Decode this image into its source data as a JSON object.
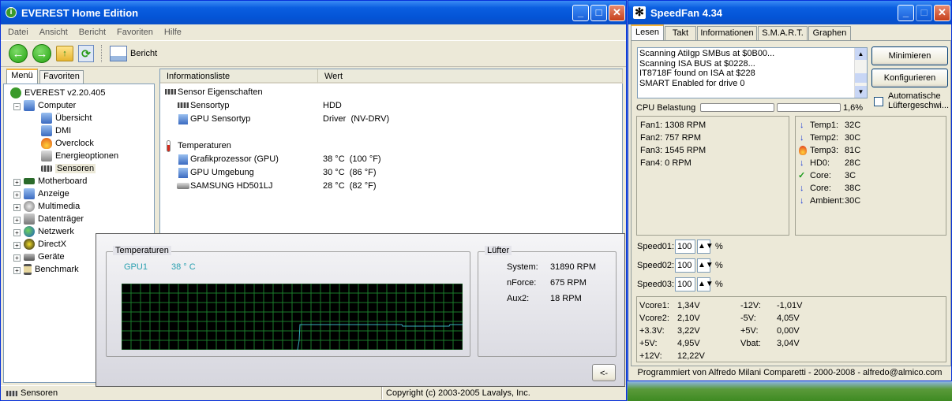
{
  "everest": {
    "title": "EVEREST Home Edition",
    "menu": [
      "Datei",
      "Ansicht",
      "Bericht",
      "Favoriten",
      "Hilfe"
    ],
    "toolbar": {
      "report_label": "Bericht"
    },
    "tabs": [
      "Menü",
      "Favoriten"
    ],
    "tree": {
      "root": "EVEREST v2.20.405",
      "computer": "Computer",
      "computer_children": [
        "Übersicht",
        "DMI",
        "Overclock",
        "Energieoptionen",
        "Sensoren"
      ],
      "others": [
        "Motherboard",
        "Anzeige",
        "Multimedia",
        "Datenträger",
        "Netzwerk",
        "DirectX",
        "Geräte",
        "Benchmark"
      ]
    },
    "columns": [
      "Informationsliste",
      "Wert"
    ],
    "section1": "Sensor Eigenschaften",
    "rows1": [
      {
        "name": "Sensortyp",
        "value": "HDD"
      },
      {
        "name": "GPU Sensortyp",
        "value": "Driver  (NV-DRV)"
      }
    ],
    "section2": "Temperaturen",
    "rows2": [
      {
        "name": "Grafikprozessor (GPU)",
        "value": "38 °C  (100 °F)"
      },
      {
        "name": "GPU Umgebung",
        "value": "30 °C  (86 °F)"
      },
      {
        "name": "SAMSUNG HD501LJ",
        "value": "28 °C  (82 °F)"
      }
    ],
    "status_left": "Sensoren",
    "status_right": "Copyright (c) 2003-2005 Lavalys, Inc."
  },
  "monitor": {
    "temp_legend": "Temperaturen",
    "gpu_label": "GPU1",
    "gpu_value": "38 ° C",
    "fan_legend": "Lüfter",
    "fans": [
      {
        "name": "System:",
        "value": "31890 RPM"
      },
      {
        "name": "nForce:",
        "value": "675 RPM"
      },
      {
        "name": "Aux2:",
        "value": "18 RPM"
      }
    ],
    "back_button": "<-"
  },
  "speedfan": {
    "title": "SpeedFan 4.34",
    "tabs": [
      "Lesen",
      "Takt",
      "Informationen",
      "S.M.A.R.T.",
      "Graphen"
    ],
    "log": [
      "Scanning AtiIgp SMBus at $0B00...",
      "Scanning ISA BUS at $0228...",
      "IT8718F found on ISA at $228",
      "SMART Enabled for drive 0"
    ],
    "minimize_button": "Minimieren",
    "configure_button": "Konfigurieren",
    "auto_fan_label": "Automatische Lüftergeschwi...",
    "cpu_label": "CPU Belastung",
    "cpu_percent": "1,6%",
    "fans": [
      "Fan1: 1308 RPM",
      "Fan2: 757 RPM",
      "Fan3: 1545 RPM",
      "Fan4: 0 RPM"
    ],
    "temps": [
      {
        "icon": "arrow-down",
        "label": "Temp1:",
        "value": "32C"
      },
      {
        "icon": "arrow-down",
        "label": "Temp2:",
        "value": "30C"
      },
      {
        "icon": "fire",
        "label": "Temp3:",
        "value": "81C"
      },
      {
        "icon": "arrow-down",
        "label": "HD0:",
        "value": "28C"
      },
      {
        "icon": "check",
        "label": "Core:",
        "value": "3C"
      },
      {
        "icon": "arrow-down",
        "label": "Core:",
        "value": "38C"
      },
      {
        "icon": "arrow-down",
        "label": "Ambient:",
        "value": "30C"
      }
    ],
    "speeds": [
      {
        "label": "Speed01:",
        "value": "100"
      },
      {
        "label": "Speed02:",
        "value": "100"
      },
      {
        "label": "Speed03:",
        "value": "100"
      }
    ],
    "percent_sign": "%",
    "volts_left": [
      {
        "label": "Vcore1:",
        "value": "1,34V"
      },
      {
        "label": "Vcore2:",
        "value": "2,10V"
      },
      {
        "label": "+3.3V:",
        "value": "3,22V"
      },
      {
        "label": "+5V:",
        "value": "4,95V"
      },
      {
        "label": "+12V:",
        "value": "12,22V"
      }
    ],
    "volts_right": [
      {
        "label": "-12V:",
        "value": "-1,01V"
      },
      {
        "label": "-5V:",
        "value": "4,05V"
      },
      {
        "label": "+5V:",
        "value": "0,00V"
      },
      {
        "label": "Vbat:",
        "value": "3,04V"
      }
    ],
    "footer": "Programmiert von Alfredo Milani Comparetti - 2000-2008 - alfredo@almico.com"
  }
}
